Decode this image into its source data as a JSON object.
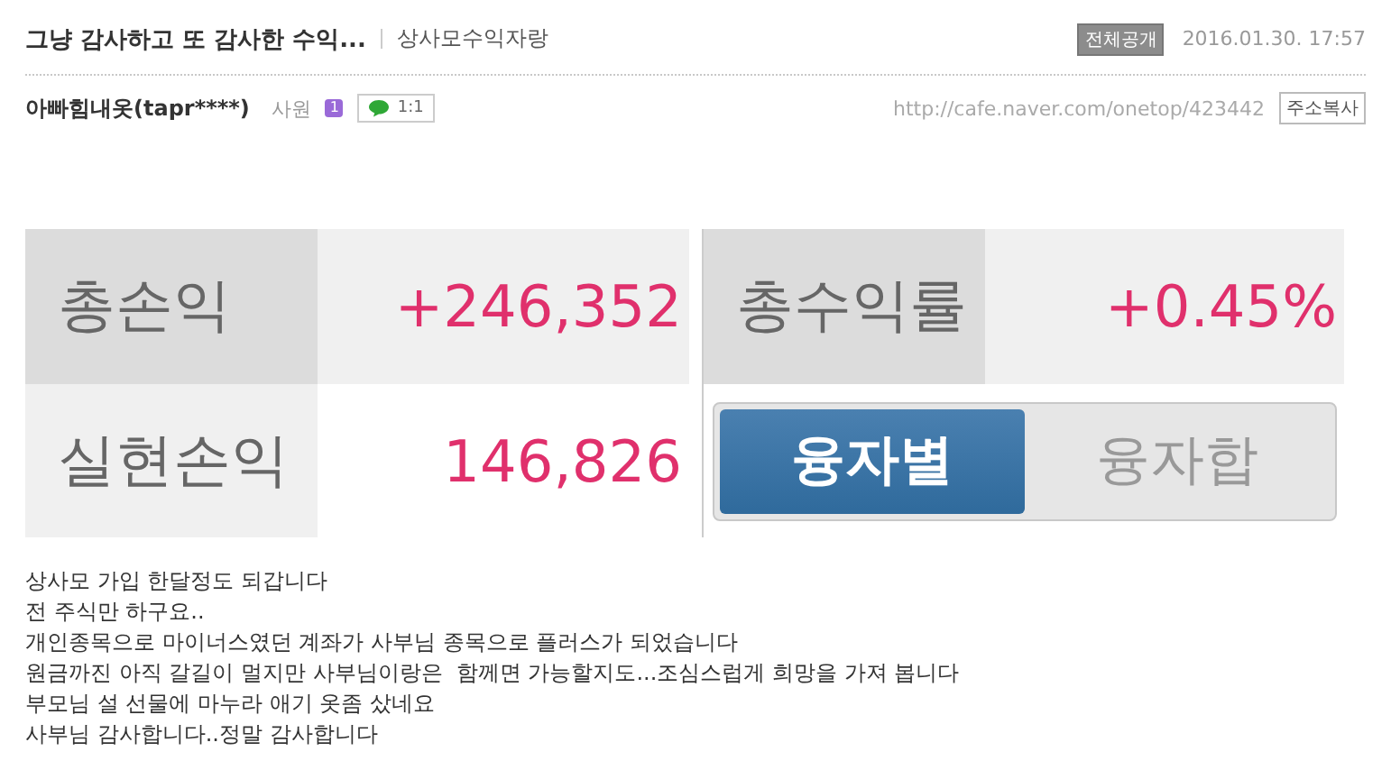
{
  "post": {
    "title": "그냥 감사하고 또 감사한 수익...",
    "board": "상사모수익자랑",
    "visibility": "전체공개",
    "date": "2016.01.30. 17:57"
  },
  "author": {
    "name": "아빠힘내옷(tapr****)",
    "rank": "사원",
    "level_badge": "1",
    "chat_label": "1:1",
    "url": "http://cafe.naver.com/onetop/423442",
    "copy_button": "주소복사"
  },
  "summary": {
    "total_profit_label": "총손익",
    "total_profit": "+246,352",
    "total_rate_label": "총수익률",
    "total_rate": "+0.45%",
    "realized_label": "실현손익",
    "realized": "146,826"
  },
  "toggle": [
    {
      "label": "융자별",
      "selected": true
    },
    {
      "label": "융자합",
      "selected": false
    }
  ],
  "body": [
    "상사모 가입 한달정도 되갑니다",
    "전 주식만 하구요..",
    "개인종목으로 마이너스였던 계좌가 사부님 종목으로 플러스가 되었습니다",
    "원금까진 아직 갈길이 멀지만 사부님이랑은  함께면 가능할지도...조심스럽게 희망을 가져 봅니다",
    "부모님 설 선물에 마누라 애기 옷좀 샀네요",
    "사부님 감사합니다..정말 감사합니다"
  ]
}
